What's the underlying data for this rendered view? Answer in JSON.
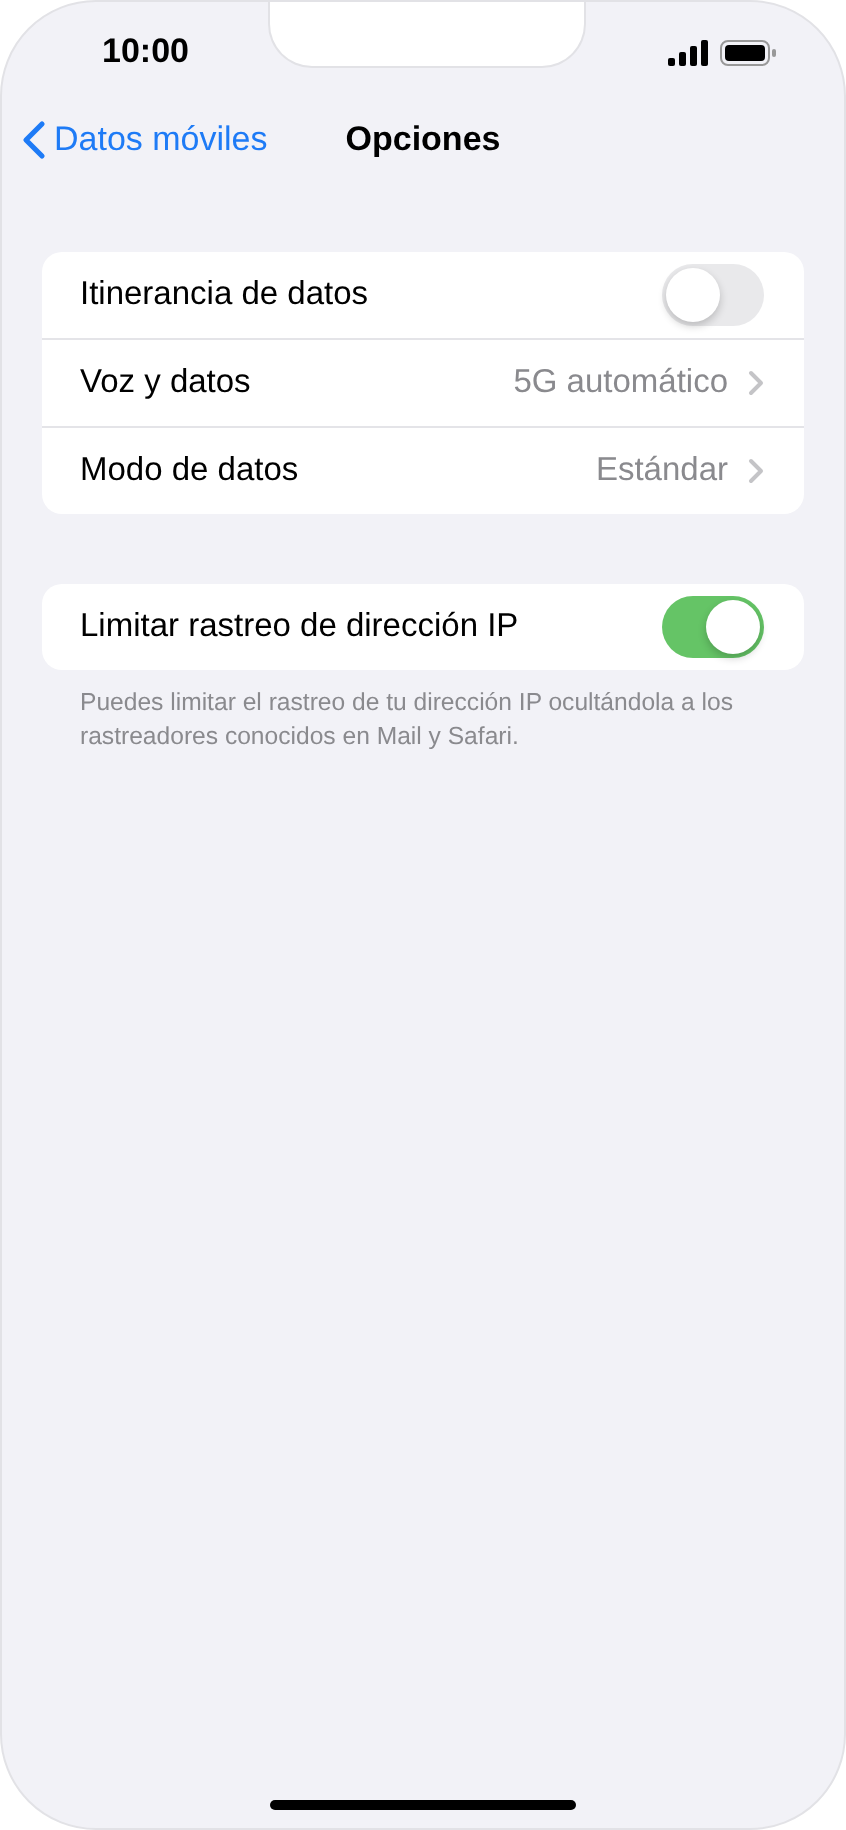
{
  "status_bar": {
    "time": "10:00"
  },
  "nav": {
    "back_label": "Datos móviles",
    "title": "Opciones"
  },
  "groups": [
    {
      "rows": [
        {
          "kind": "toggle",
          "label": "Itinerancia de datos",
          "on": false
        },
        {
          "kind": "link",
          "label": "Voz y datos",
          "value": "5G automático"
        },
        {
          "kind": "link",
          "label": "Modo de datos",
          "value": "Estándar"
        }
      ]
    },
    {
      "rows": [
        {
          "kind": "toggle",
          "label": "Limitar rastreo de dirección IP",
          "on": true
        }
      ],
      "footer": "Puedes limitar el rastreo de tu dirección IP ocultándola a los rastreadores conocidos en Mail y Safari."
    }
  ]
}
